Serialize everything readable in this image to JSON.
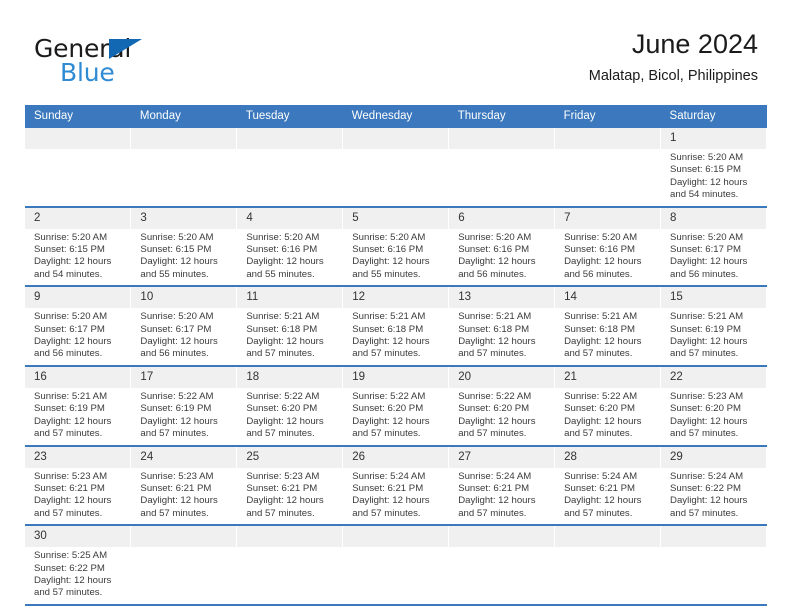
{
  "brand": {
    "name_top": "General",
    "name_bottom": "Blue",
    "accent_color": "#2e8bd4",
    "triangle_color": "#1268b3"
  },
  "header": {
    "title": "June 2024",
    "subtitle": "Malatap, Bicol, Philippines"
  },
  "theme": {
    "header_row_bg": "#3b78bd",
    "daynum_bg": "#f0f0f0",
    "row_divider": "#3b78bd",
    "text": "#3b3b3b"
  },
  "weekday_headers": [
    "Sunday",
    "Monday",
    "Tuesday",
    "Wednesday",
    "Thursday",
    "Friday",
    "Saturday"
  ],
  "labels": {
    "sunrise_prefix": "Sunrise:",
    "sunset_prefix": "Sunset:",
    "daylight_prefix": "Daylight:"
  },
  "weeks": [
    [
      {
        "day": "",
        "blank": true
      },
      {
        "day": "",
        "blank": true
      },
      {
        "day": "",
        "blank": true
      },
      {
        "day": "",
        "blank": true
      },
      {
        "day": "",
        "blank": true
      },
      {
        "day": "",
        "blank": true
      },
      {
        "day": "1",
        "sunrise": "Sunrise: 5:20 AM",
        "sunset": "Sunset: 6:15 PM",
        "daylight1": "Daylight: 12 hours",
        "daylight2": "and 54 minutes."
      }
    ],
    [
      {
        "day": "2",
        "sunrise": "Sunrise: 5:20 AM",
        "sunset": "Sunset: 6:15 PM",
        "daylight1": "Daylight: 12 hours",
        "daylight2": "and 54 minutes."
      },
      {
        "day": "3",
        "sunrise": "Sunrise: 5:20 AM",
        "sunset": "Sunset: 6:15 PM",
        "daylight1": "Daylight: 12 hours",
        "daylight2": "and 55 minutes."
      },
      {
        "day": "4",
        "sunrise": "Sunrise: 5:20 AM",
        "sunset": "Sunset: 6:16 PM",
        "daylight1": "Daylight: 12 hours",
        "daylight2": "and 55 minutes."
      },
      {
        "day": "5",
        "sunrise": "Sunrise: 5:20 AM",
        "sunset": "Sunset: 6:16 PM",
        "daylight1": "Daylight: 12 hours",
        "daylight2": "and 55 minutes."
      },
      {
        "day": "6",
        "sunrise": "Sunrise: 5:20 AM",
        "sunset": "Sunset: 6:16 PM",
        "daylight1": "Daylight: 12 hours",
        "daylight2": "and 56 minutes."
      },
      {
        "day": "7",
        "sunrise": "Sunrise: 5:20 AM",
        "sunset": "Sunset: 6:16 PM",
        "daylight1": "Daylight: 12 hours",
        "daylight2": "and 56 minutes."
      },
      {
        "day": "8",
        "sunrise": "Sunrise: 5:20 AM",
        "sunset": "Sunset: 6:17 PM",
        "daylight1": "Daylight: 12 hours",
        "daylight2": "and 56 minutes."
      }
    ],
    [
      {
        "day": "9",
        "sunrise": "Sunrise: 5:20 AM",
        "sunset": "Sunset: 6:17 PM",
        "daylight1": "Daylight: 12 hours",
        "daylight2": "and 56 minutes."
      },
      {
        "day": "10",
        "sunrise": "Sunrise: 5:20 AM",
        "sunset": "Sunset: 6:17 PM",
        "daylight1": "Daylight: 12 hours",
        "daylight2": "and 56 minutes."
      },
      {
        "day": "11",
        "sunrise": "Sunrise: 5:21 AM",
        "sunset": "Sunset: 6:18 PM",
        "daylight1": "Daylight: 12 hours",
        "daylight2": "and 57 minutes."
      },
      {
        "day": "12",
        "sunrise": "Sunrise: 5:21 AM",
        "sunset": "Sunset: 6:18 PM",
        "daylight1": "Daylight: 12 hours",
        "daylight2": "and 57 minutes."
      },
      {
        "day": "13",
        "sunrise": "Sunrise: 5:21 AM",
        "sunset": "Sunset: 6:18 PM",
        "daylight1": "Daylight: 12 hours",
        "daylight2": "and 57 minutes."
      },
      {
        "day": "14",
        "sunrise": "Sunrise: 5:21 AM",
        "sunset": "Sunset: 6:18 PM",
        "daylight1": "Daylight: 12 hours",
        "daylight2": "and 57 minutes."
      },
      {
        "day": "15",
        "sunrise": "Sunrise: 5:21 AM",
        "sunset": "Sunset: 6:19 PM",
        "daylight1": "Daylight: 12 hours",
        "daylight2": "and 57 minutes."
      }
    ],
    [
      {
        "day": "16",
        "sunrise": "Sunrise: 5:21 AM",
        "sunset": "Sunset: 6:19 PM",
        "daylight1": "Daylight: 12 hours",
        "daylight2": "and 57 minutes."
      },
      {
        "day": "17",
        "sunrise": "Sunrise: 5:22 AM",
        "sunset": "Sunset: 6:19 PM",
        "daylight1": "Daylight: 12 hours",
        "daylight2": "and 57 minutes."
      },
      {
        "day": "18",
        "sunrise": "Sunrise: 5:22 AM",
        "sunset": "Sunset: 6:20 PM",
        "daylight1": "Daylight: 12 hours",
        "daylight2": "and 57 minutes."
      },
      {
        "day": "19",
        "sunrise": "Sunrise: 5:22 AM",
        "sunset": "Sunset: 6:20 PM",
        "daylight1": "Daylight: 12 hours",
        "daylight2": "and 57 minutes."
      },
      {
        "day": "20",
        "sunrise": "Sunrise: 5:22 AM",
        "sunset": "Sunset: 6:20 PM",
        "daylight1": "Daylight: 12 hours",
        "daylight2": "and 57 minutes."
      },
      {
        "day": "21",
        "sunrise": "Sunrise: 5:22 AM",
        "sunset": "Sunset: 6:20 PM",
        "daylight1": "Daylight: 12 hours",
        "daylight2": "and 57 minutes."
      },
      {
        "day": "22",
        "sunrise": "Sunrise: 5:23 AM",
        "sunset": "Sunset: 6:20 PM",
        "daylight1": "Daylight: 12 hours",
        "daylight2": "and 57 minutes."
      }
    ],
    [
      {
        "day": "23",
        "sunrise": "Sunrise: 5:23 AM",
        "sunset": "Sunset: 6:21 PM",
        "daylight1": "Daylight: 12 hours",
        "daylight2": "and 57 minutes."
      },
      {
        "day": "24",
        "sunrise": "Sunrise: 5:23 AM",
        "sunset": "Sunset: 6:21 PM",
        "daylight1": "Daylight: 12 hours",
        "daylight2": "and 57 minutes."
      },
      {
        "day": "25",
        "sunrise": "Sunrise: 5:23 AM",
        "sunset": "Sunset: 6:21 PM",
        "daylight1": "Daylight: 12 hours",
        "daylight2": "and 57 minutes."
      },
      {
        "day": "26",
        "sunrise": "Sunrise: 5:24 AM",
        "sunset": "Sunset: 6:21 PM",
        "daylight1": "Daylight: 12 hours",
        "daylight2": "and 57 minutes."
      },
      {
        "day": "27",
        "sunrise": "Sunrise: 5:24 AM",
        "sunset": "Sunset: 6:21 PM",
        "daylight1": "Daylight: 12 hours",
        "daylight2": "and 57 minutes."
      },
      {
        "day": "28",
        "sunrise": "Sunrise: 5:24 AM",
        "sunset": "Sunset: 6:21 PM",
        "daylight1": "Daylight: 12 hours",
        "daylight2": "and 57 minutes."
      },
      {
        "day": "29",
        "sunrise": "Sunrise: 5:24 AM",
        "sunset": "Sunset: 6:22 PM",
        "daylight1": "Daylight: 12 hours",
        "daylight2": "and 57 minutes."
      }
    ],
    [
      {
        "day": "30",
        "sunrise": "Sunrise: 5:25 AM",
        "sunset": "Sunset: 6:22 PM",
        "daylight1": "Daylight: 12 hours",
        "daylight2": "and 57 minutes."
      },
      {
        "day": "",
        "blank": true
      },
      {
        "day": "",
        "blank": true
      },
      {
        "day": "",
        "blank": true
      },
      {
        "day": "",
        "blank": true
      },
      {
        "day": "",
        "blank": true
      },
      {
        "day": "",
        "blank": true
      }
    ]
  ]
}
